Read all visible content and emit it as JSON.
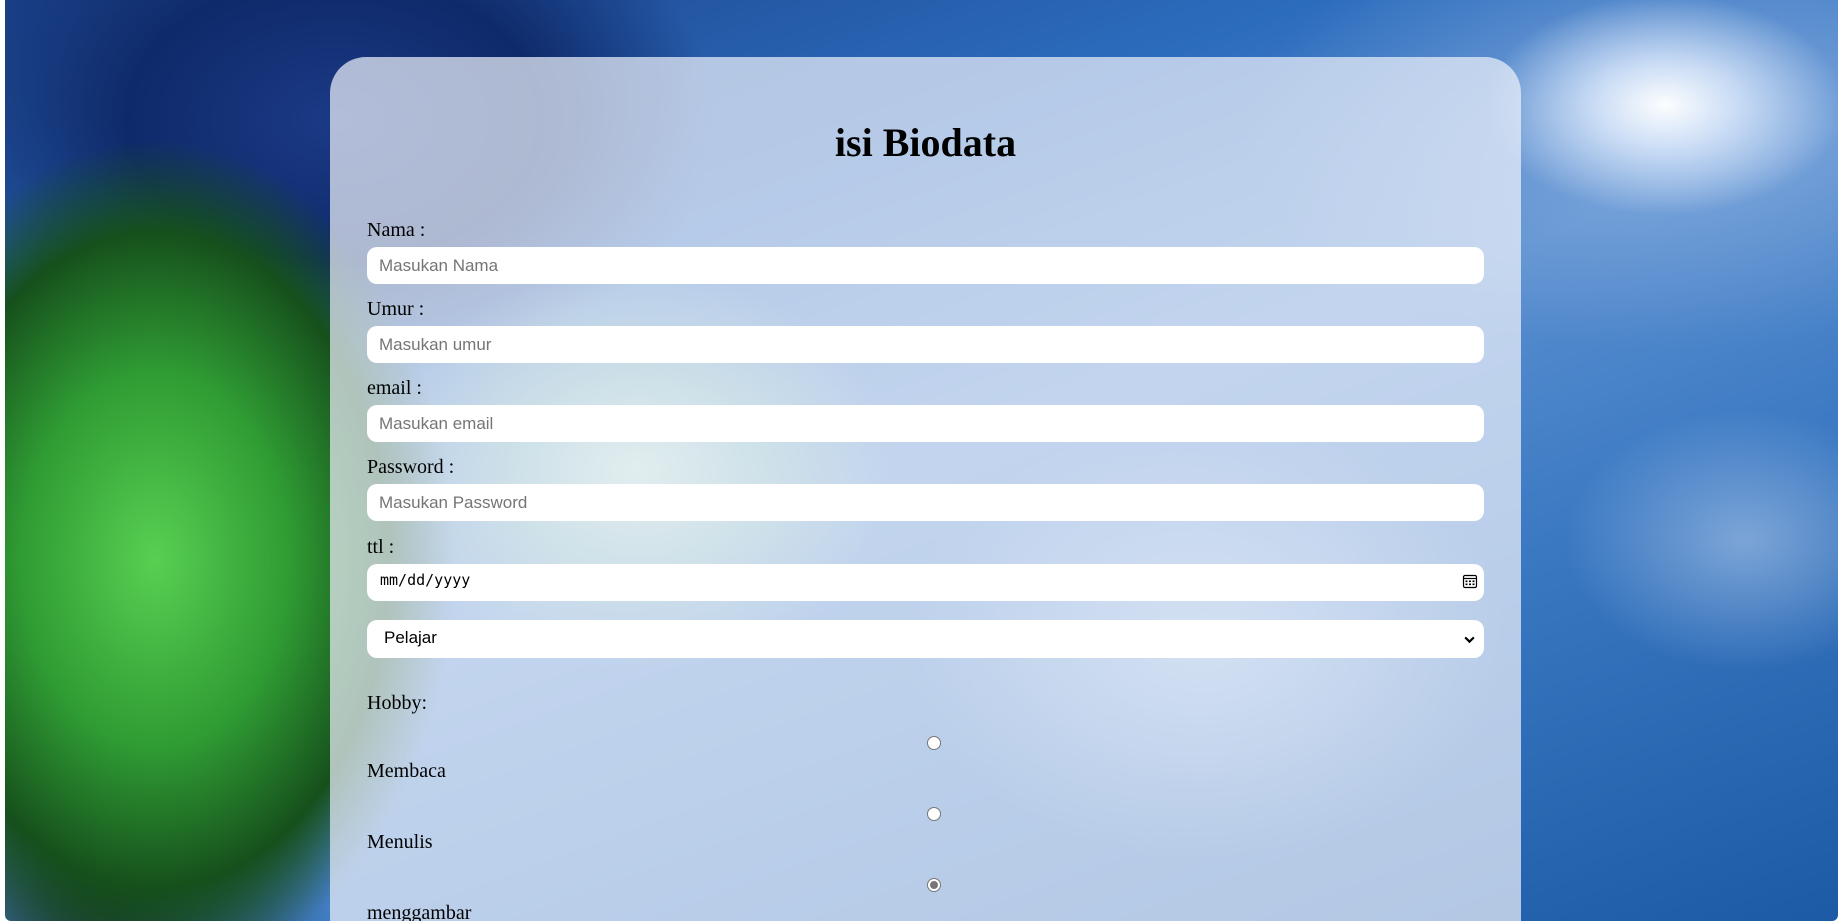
{
  "form": {
    "title": "isi Biodata",
    "fields": [
      {
        "label": "Nama :",
        "placeholder": "Masukan Nama"
      },
      {
        "label": "Umur :",
        "placeholder": "Masukan umur"
      },
      {
        "label": "email :",
        "placeholder": "Masukan email"
      },
      {
        "label": "Password :",
        "placeholder": "Masukan Password"
      }
    ],
    "ttl": {
      "label": "ttl :",
      "placeholder": "mm/dd/yyyy"
    },
    "status_select": {
      "selected": "Pelajar"
    },
    "hobby": {
      "label": "Hobby:",
      "options": [
        {
          "label": "Membaca",
          "checked": false
        },
        {
          "label": "Menulis",
          "checked": false
        },
        {
          "label": "menggambar",
          "checked": true
        }
      ]
    }
  },
  "icons": {
    "date_picker": "calendar-icon",
    "select_arrow": "chevron-down-icon"
  }
}
